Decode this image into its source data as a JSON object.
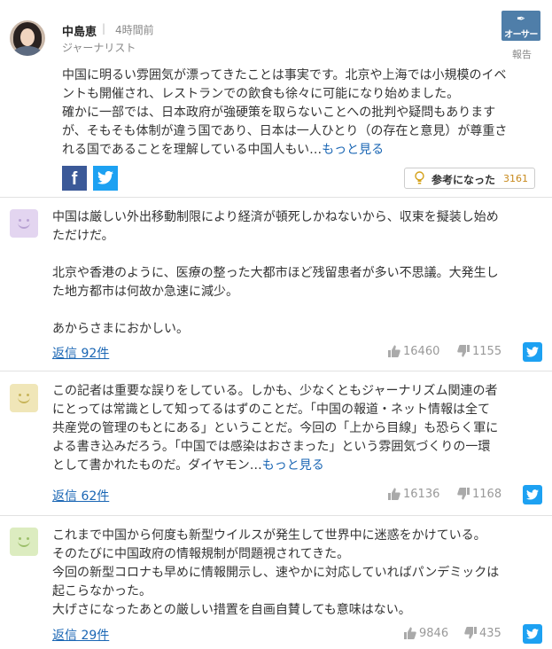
{
  "author": {
    "name": "中島恵",
    "separator": "|",
    "time": "4時間前",
    "role": "ジャーナリスト",
    "badge": "オーサー",
    "report": "報告",
    "paragraphs": [
      "中国に明るい雰囲気が漂ってきたことは事実です。北京や上海では小規模のイベ",
      "ントも開催され、レストランでの飲食も徐々に可能になり始めました。",
      "確かに一部では、日本政府が強硬策を取らないことへの批判や疑問もあります",
      "が、そもそも体制が違う国であり、日本は一人ひとり（の存在と意見）が尊重さ",
      "れる国であることを理解している中国人もい…"
    ],
    "more": "もっと見る",
    "facebook_label": "f",
    "helpful_label": "参考になった",
    "helpful_count": "3161"
  },
  "comments": [
    {
      "avatar_color": "#e3d5f0",
      "feature_color": "#b8a2d3",
      "lines": [
        "中国は厳しい外出移動制限により経済が頓死しかねないから、収束を擬装し始め",
        "ただけだ。",
        "",
        "北京や香港のように、医療の整った大都市ほど残留患者が多い不思議。大発生し",
        "た地方都市は何故か急速に減少。",
        "",
        "あからさまにおかしい。"
      ],
      "more": "",
      "reply": "返信 92件",
      "likes": "16460",
      "dislikes": "1155"
    },
    {
      "avatar_color": "#f0e6b8",
      "feature_color": "#c7b45a",
      "lines": [
        "この記者は重要な誤りをしている。しかも、少なくともジャーナリズム関連の者",
        "にとっては常識として知ってるはずのことだ。「中国の報道・ネット情報は全て",
        "共産党の管理のもとにある」ということだ。今回の「上から目線」も恐らく軍に",
        "よる書き込みだろう。「中国では感染はおさまった」という雰囲気づくりの一環",
        "として書かれたものだ。ダイヤモン…"
      ],
      "more": "もっと見る",
      "reply": "返信 62件",
      "likes": "16136",
      "dislikes": "1168"
    },
    {
      "avatar_color": "#dcecc0",
      "feature_color": "#9cbf6a",
      "lines": [
        "これまで中国から何度も新型ウイルスが発生して世界中に迷惑をかけている。",
        "そのたびに中国政府の情報規制が問題視されてきた。",
        "今回の新型コロナも早めに情報開示し、速やかに対応していればパンデミックは",
        "起こらなかった。",
        "大げさになったあとの厳しい措置を自画自賛しても意味はない。"
      ],
      "more": "",
      "reply": "返信 29件",
      "likes": "9846",
      "dislikes": "435"
    }
  ]
}
